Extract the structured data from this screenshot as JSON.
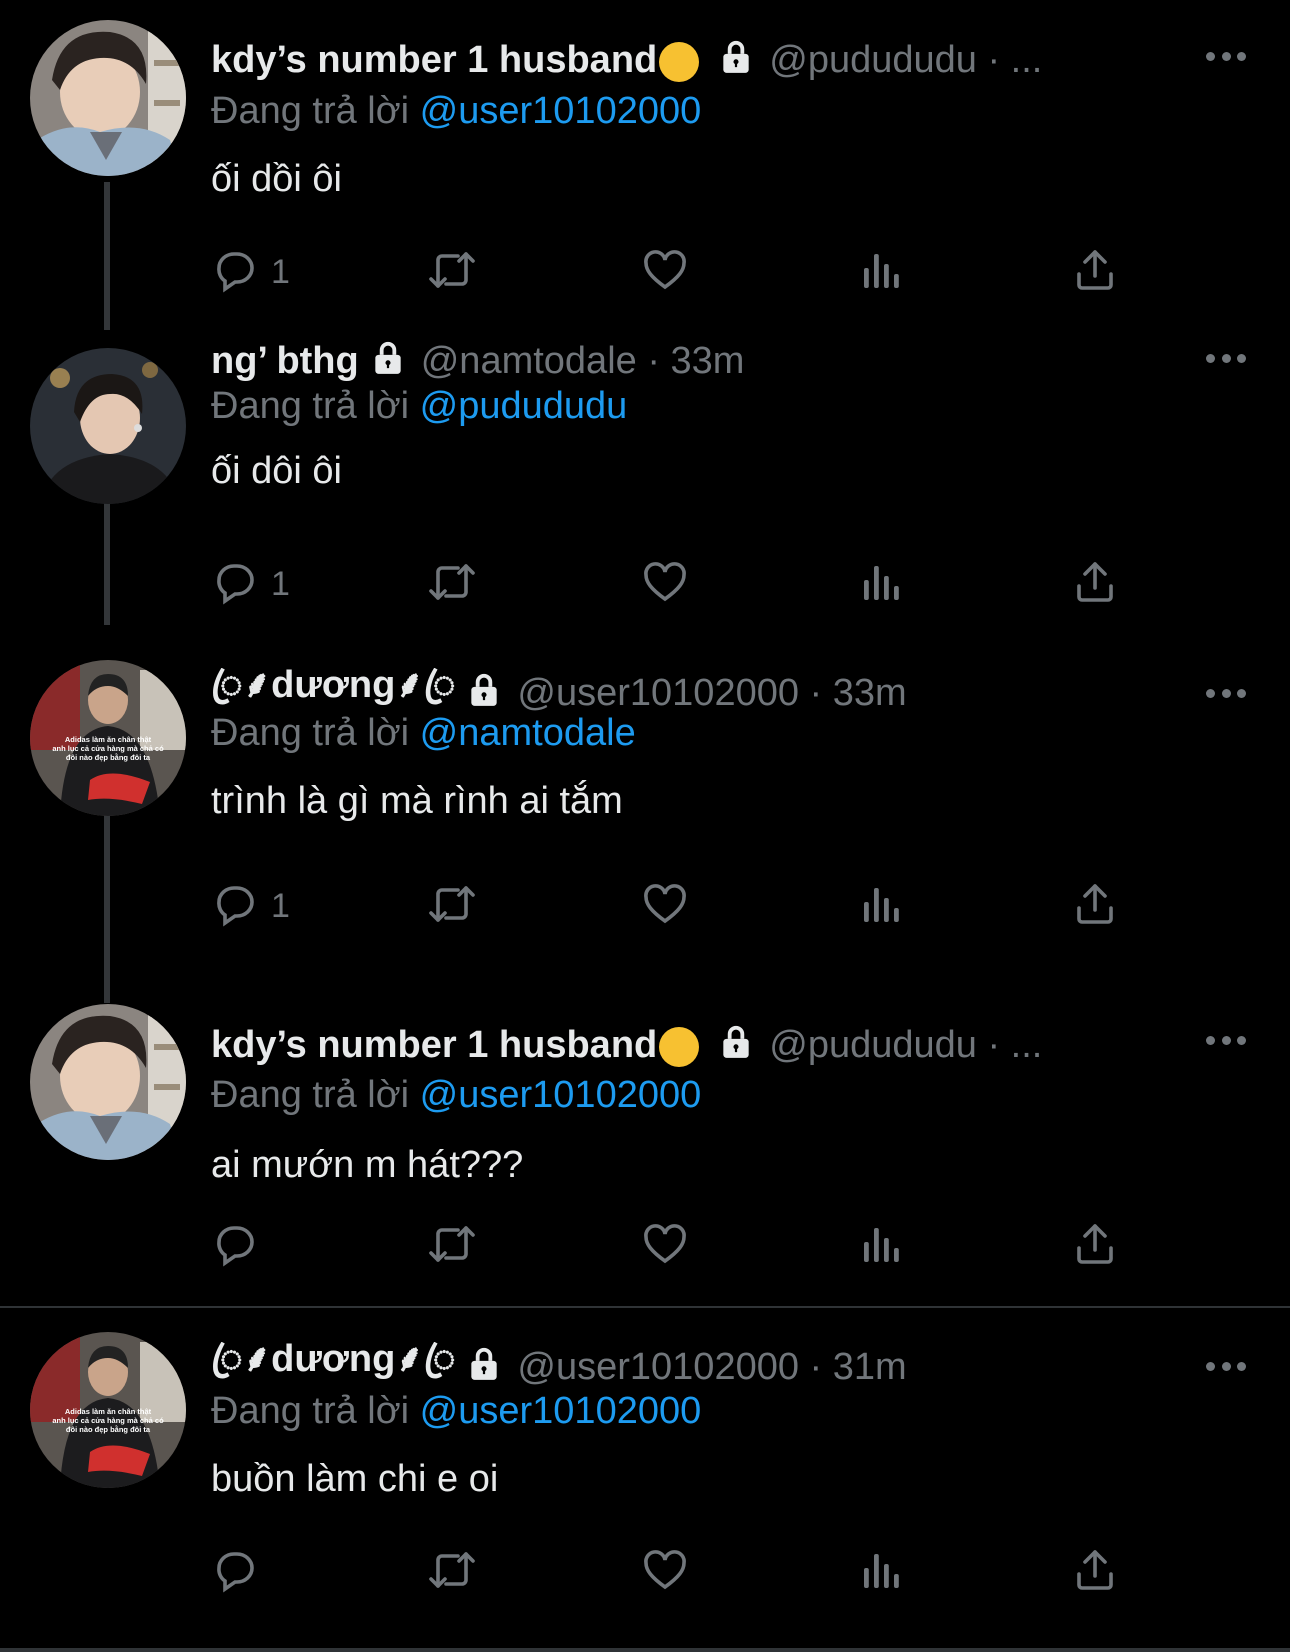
{
  "tweets": [
    {
      "name": "kdy’s number 1 husband",
      "handle": "@pudududu · ...",
      "replying_prefix": "Đang trả lời ",
      "replying_to": "@user10102000",
      "text": "ối dồi ôi",
      "reply_count": "1",
      "emoji": "tired-face-emoji"
    },
    {
      "name": "ng’ bthg",
      "handle": "@namtodale · 33m",
      "replying_prefix": "Đang trả lời ",
      "replying_to": "@pudududu",
      "text": "ối dôi ôi",
      "reply_count": "1"
    },
    {
      "name": "ꦿ⸙dương⸙ꦿ",
      "handle": "@user10102000 · 33m",
      "replying_prefix": "Đang trả lời ",
      "replying_to": "@namtodale",
      "text": "trình là gì mà rình ai tắm",
      "reply_count": "1",
      "avatar_caption": [
        "Adidas làm ăn chân thật",
        "anh lục cả cửa hàng mà chả có",
        "đôi nào đẹp bằng đôi ta"
      ]
    },
    {
      "name": "kdy’s number 1 husband",
      "handle": "@pudududu · ...",
      "replying_prefix": "Đang trả lời ",
      "replying_to": "@user10102000",
      "text": "ai mướn m hát???",
      "reply_count": ""
    },
    {
      "name": "ꦿ⸙dương⸙ꦿ",
      "handle": "@user10102000 · 31m",
      "replying_prefix": "Đang trả lời ",
      "replying_to": "@user10102000",
      "text": "buồn làm chi e oi",
      "reply_count": "",
      "avatar_caption": [
        "Adidas làm ăn chân thật",
        "anh lục cả cửa hàng mà chả có",
        "đôi nào đẹp bằng đôi ta"
      ]
    }
  ],
  "colors": {
    "background": "#000000",
    "text": "#e7e9ea",
    "muted": "#71767b",
    "link": "#1d9bf0",
    "thread_line": "#333639"
  },
  "icons": [
    "reply-icon",
    "retweet-icon",
    "like-icon",
    "views-icon",
    "share-icon",
    "lock-icon",
    "more-icon"
  ]
}
